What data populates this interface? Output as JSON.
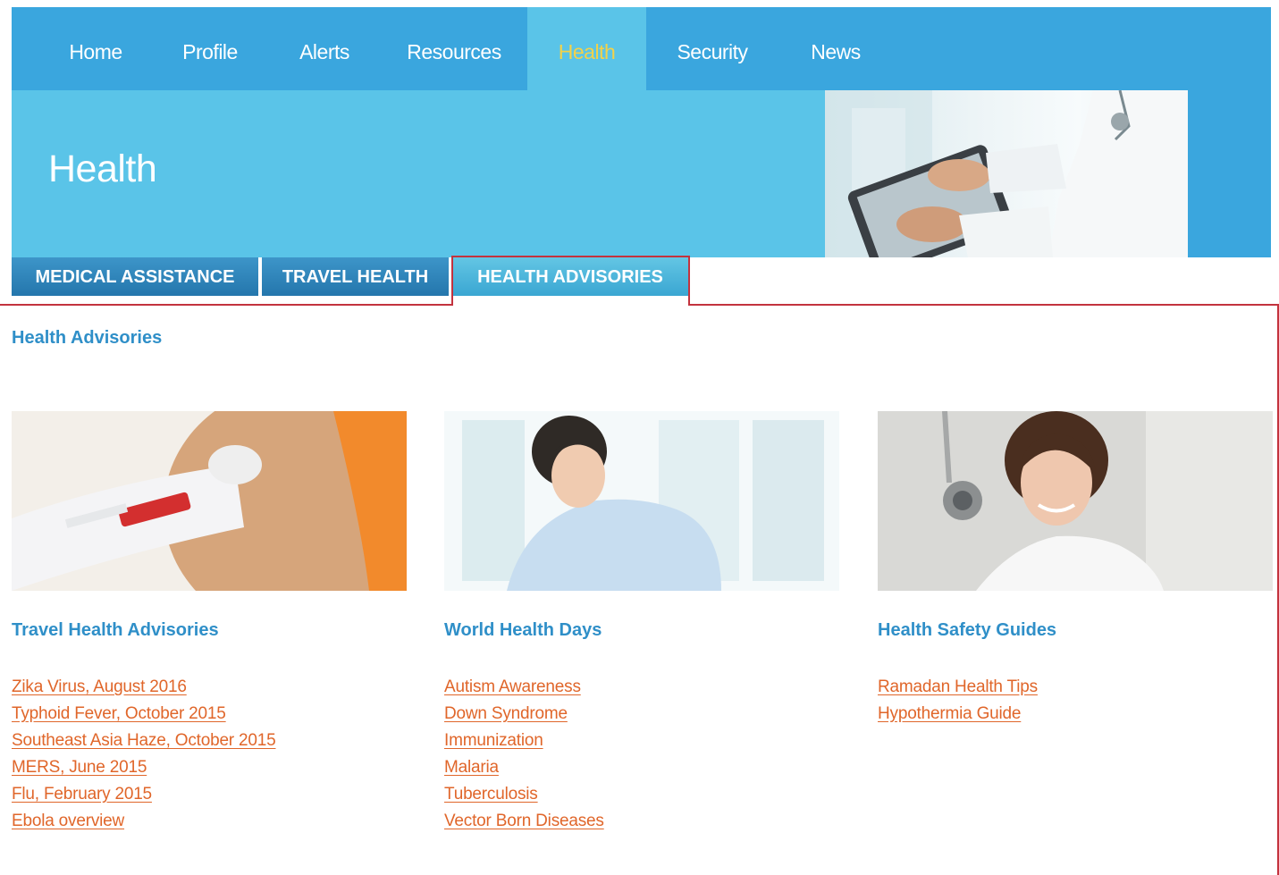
{
  "nav": {
    "items": [
      {
        "label": "Home"
      },
      {
        "label": "Profile"
      },
      {
        "label": "Alerts"
      },
      {
        "label": "Resources"
      },
      {
        "label": "Health"
      },
      {
        "label": "Security"
      },
      {
        "label": "News"
      }
    ],
    "active": "Health"
  },
  "hero": {
    "title": "Health"
  },
  "tabs": [
    {
      "label": "MEDICAL ASSISTANCE"
    },
    {
      "label": "TRAVEL HEALTH"
    },
    {
      "label": "HEALTH ADVISORIES"
    }
  ],
  "active_tab": "HEALTH ADVISORIES",
  "section": {
    "title": "Health Advisories"
  },
  "columns": [
    {
      "title": "Travel Health Advisories",
      "links": [
        "Zika Virus, August 2016",
        "Typhoid Fever, October 2015",
        "Southeast Asia Haze, October 2015",
        "MERS, June 2015",
        "Flu, February 2015",
        "Ebola overview"
      ]
    },
    {
      "title": "World Health Days",
      "links": [
        "Autism Awareness",
        "Down Syndrome",
        "Immunization",
        "Malaria",
        "Tuberculosis",
        "Vector Born Diseases"
      ]
    },
    {
      "title": "Health Safety Guides",
      "links": [
        "Ramadan Health Tips",
        "Hypothermia Guide"
      ]
    }
  ],
  "colors": {
    "nav_bg": "#3aa6de",
    "hero_bg": "#5ac4e8",
    "active_nav_text": "#f3d24a",
    "heading": "#2f8fc8",
    "link": "#e0662a",
    "highlight_outline": "#c3333e"
  }
}
